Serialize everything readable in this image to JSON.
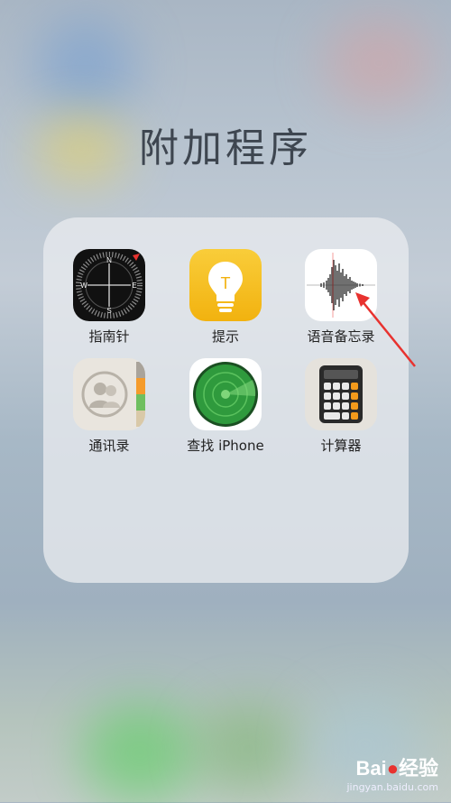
{
  "folder": {
    "title": "附加程序",
    "apps": [
      {
        "label": "指南针",
        "icon": "compass-icon"
      },
      {
        "label": "提示",
        "icon": "tips-bulb-icon"
      },
      {
        "label": "语音备忘录",
        "icon": "voice-memos-waveform-icon"
      },
      {
        "label": "通讯录",
        "icon": "contacts-icon"
      },
      {
        "label": "查找 iPhone",
        "icon": "find-iphone-radar-icon"
      },
      {
        "label": "计算器",
        "icon": "calculator-icon"
      }
    ]
  },
  "compass": {
    "n": "N",
    "e": "E",
    "s": "S",
    "w": "W"
  },
  "tips": {
    "letter": "T"
  },
  "watermark": {
    "brand": "Bai",
    "brand2": "经验",
    "domain": "jingyan.baidu.com"
  },
  "colors": {
    "accent_arrow": "#e8322f",
    "tips_bg": "#f7c21e",
    "radar_green": "#2f9a3d"
  }
}
